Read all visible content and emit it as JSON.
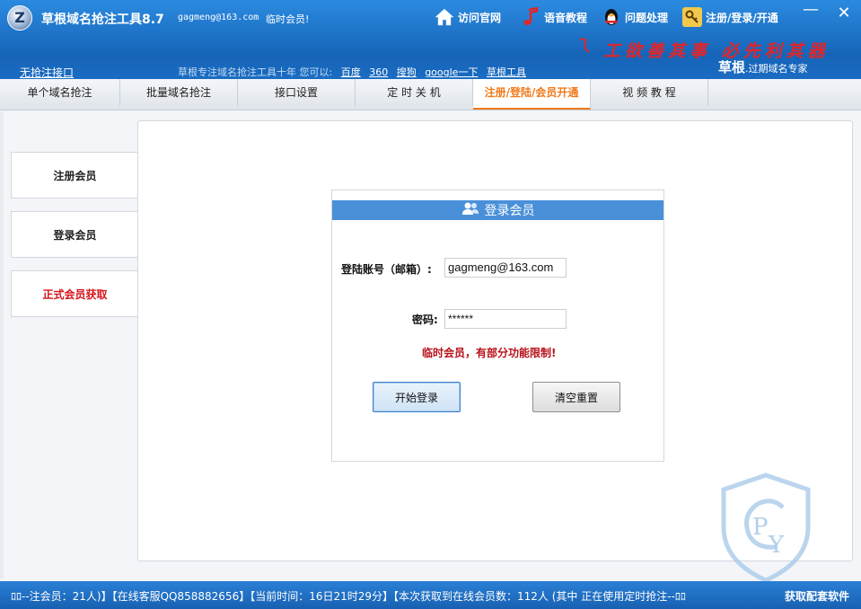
{
  "window": {
    "title": "草根域名抢注工具8.7",
    "user_email": "gagmeng@163.com",
    "user_status": "临时会员!",
    "logo_letter": "Z",
    "minimize_glyph": "—",
    "close_glyph": "✕"
  },
  "topnav": {
    "visit": "访问官网",
    "voice": "语音教程",
    "issue": "问题处理",
    "register": "注册/登录/开通"
  },
  "slogan": "工欲善其事 必先利其器",
  "brand": {
    "name": "草根",
    "subtitle": ".过期域名专家"
  },
  "infobar": {
    "no_api": "无抢注接口",
    "text": "草根专注域名抢注工具十年 您可以:",
    "links": [
      "百度",
      "360",
      "搜狗",
      "google一下",
      "草根工具"
    ]
  },
  "tabs": [
    {
      "label": "单个域名抢注"
    },
    {
      "label": "批量域名抢注"
    },
    {
      "label": "接口设置"
    },
    {
      "label": "定 时 关 机"
    },
    {
      "label": "注册/登陆/会员开通"
    },
    {
      "label": "视 频 教 程"
    }
  ],
  "sidebar": [
    {
      "label": "注册会员"
    },
    {
      "label": "登录会员"
    },
    {
      "label": "正式会员获取"
    }
  ],
  "login": {
    "header": "登录会员",
    "account_label": "登陆账号（邮箱）:",
    "account_value": "gagmeng@163.com",
    "password_label": "密码:",
    "password_value": "******",
    "warning": "临时会员，有部分功能限制!",
    "login_button": "开始登录",
    "reset_button": "清空重置"
  },
  "statusbar": {
    "text": "ﾛﾛ--注会员：21人)】【在线客服QQ858882656】【当前时间：16日21时29分】【本次获取到在线会员数：112人 (其中 正在使用定时抢注--ﾛﾛ",
    "get_software": "获取配套软件"
  },
  "colors": {
    "accent": "#f07a1a",
    "warning": "#b8121a",
    "header_blue": "#1664b8"
  }
}
